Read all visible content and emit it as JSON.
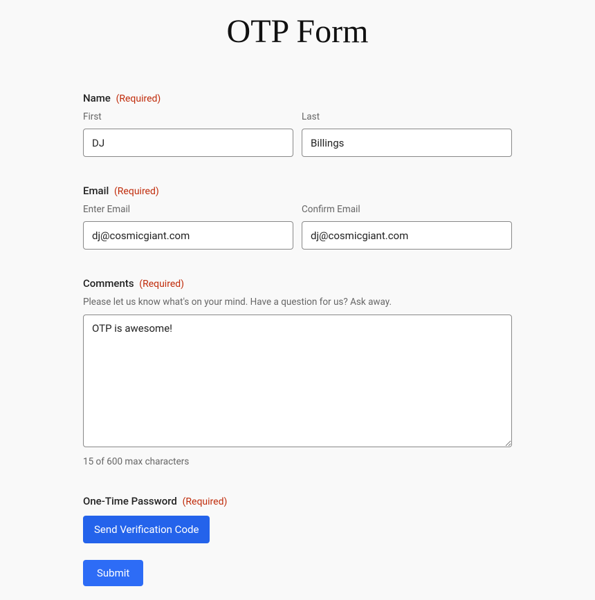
{
  "page": {
    "title": "OTP Form"
  },
  "required_label": "(Required)",
  "name": {
    "label": "Name",
    "first_label": "First",
    "last_label": "Last",
    "first_value": "DJ",
    "last_value": "Billings"
  },
  "email": {
    "label": "Email",
    "enter_label": "Enter Email",
    "confirm_label": "Confirm Email",
    "enter_value": "dj@cosmicgiant.com",
    "confirm_value": "dj@cosmicgiant.com"
  },
  "comments": {
    "label": "Comments",
    "helper": "Please let us know what's on your mind. Have a question for us? Ask away.",
    "value": "OTP is awesome!",
    "counter": "15 of 600 max characters"
  },
  "otp": {
    "label": "One-Time Password",
    "send_button": "Send Verification Code"
  },
  "submit_label": "Submit"
}
